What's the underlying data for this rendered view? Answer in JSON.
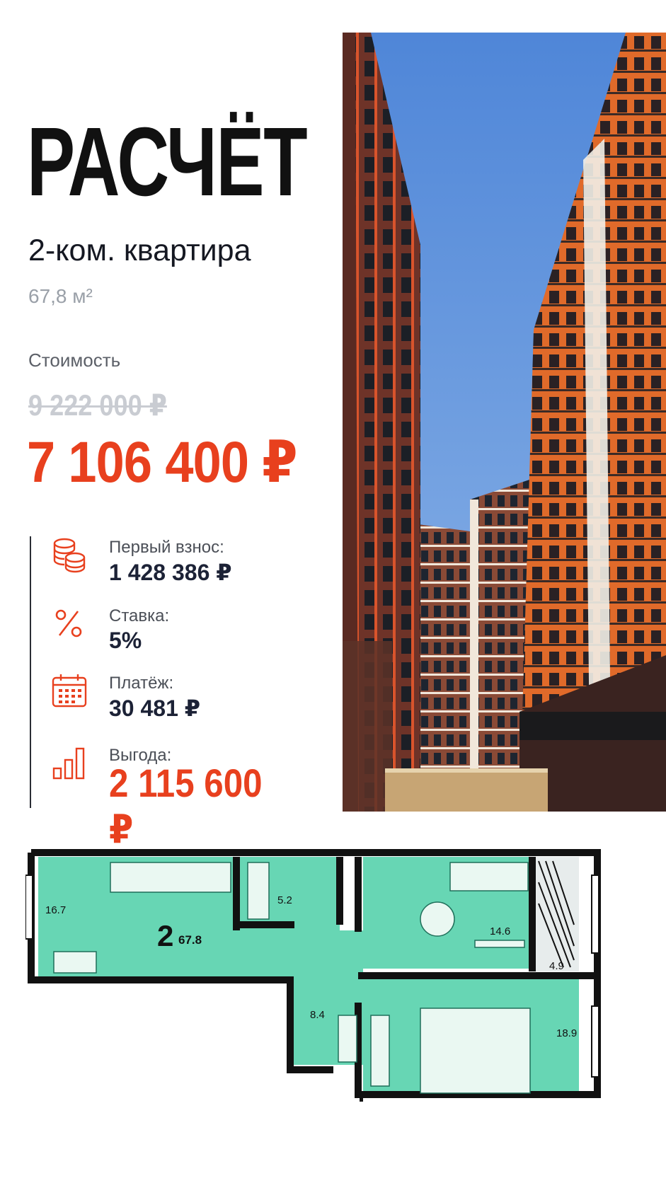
{
  "title": "РАСЧЁТ",
  "subtitle": "2-ком. квартира",
  "area": "67,8 м²",
  "cost_label": "Стоимость",
  "old_price": "9 222 000 ₽",
  "new_price": "7 106 400 ₽",
  "stats": [
    {
      "icon": "coins-stack-icon",
      "label": "Первый взнос:",
      "value": "1 428 386 ₽"
    },
    {
      "icon": "percent-icon",
      "label": "Ставка:",
      "value": "5%"
    },
    {
      "icon": "calendar-icon",
      "label": "Платёж:",
      "value": "30 481 ₽"
    },
    {
      "icon": "bar-chart-icon",
      "label": "Выгода:",
      "value": "2 115 600 ₽"
    }
  ],
  "plan": {
    "rooms_count": "2",
    "total_area": "67.8",
    "room_areas": [
      "16.7",
      "5.2",
      "14.6",
      "4.9",
      "8.4",
      "18.9"
    ]
  },
  "colors": {
    "accent": "#e8401e",
    "room_fill": "#67d6b4",
    "wall": "#111111",
    "sky": "#5a8fd6",
    "brick": "#7a3a2c",
    "orange": "#e06a2a"
  }
}
